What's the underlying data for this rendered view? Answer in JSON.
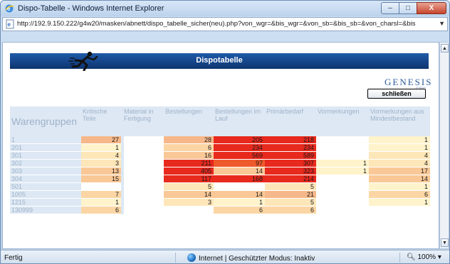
{
  "window": {
    "title": "Dispo-Tabelle - Windows Internet Explorer",
    "url": "http://192.9.150.222/g4w20/masken/abnett/dispo_tabelle_sicher(neu).php?von_wgr=&bis_wgr=&von_sb=&bis_sb=&von_charsl=&bis",
    "controls": {
      "minimize": "–",
      "maximize": "□",
      "close": "X"
    }
  },
  "page": {
    "header_title": "Dispotabelle",
    "logo": {
      "text": "GENESIS",
      "sub": "d Web"
    },
    "close_button": "schließen"
  },
  "table": {
    "columns": [
      "Warengruppen",
      "Kritische Teile",
      "Material in Fertigung",
      "Bestellungen",
      "Bestellungen im Lauf",
      "Primärbedarf",
      "Vormerkungen",
      "Vormerkungen aus Mindestbestand"
    ],
    "rows": [
      {
        "label": "1",
        "cells": [
          "27",
          "",
          "28",
          "205",
          "218",
          "",
          "1"
        ],
        "colors": [
          "#f6b88a",
          "#ffffff",
          "#f6b88a",
          "#e8291d",
          "#e8291d",
          "#ffffff",
          "#fff3cc"
        ]
      },
      {
        "label": "201",
        "cells": [
          "1",
          "",
          "6",
          "234",
          "234",
          "",
          "1"
        ],
        "colors": [
          "#fff3cc",
          "#ffffff",
          "#fbd6a4",
          "#e8291d",
          "#e8291d",
          "#ffffff",
          "#fff3cc"
        ]
      },
      {
        "label": "301",
        "cells": [
          "4",
          "",
          "16",
          "569",
          "589",
          "",
          "4"
        ],
        "colors": [
          "#fde6b8",
          "#ffffff",
          "#f9c896",
          "#e8291d",
          "#e8291d",
          "#ffffff",
          "#fde6b8"
        ]
      },
      {
        "label": "302",
        "cells": [
          "3",
          "",
          "211",
          "97",
          "307",
          "1",
          "4"
        ],
        "colors": [
          "#fde6b8",
          "#ffffff",
          "#e8291d",
          "#ef5a2c",
          "#e8291d",
          "#fff3cc",
          "#fde6b8"
        ]
      },
      {
        "label": "303",
        "cells": [
          "13",
          "",
          "405",
          "14",
          "323",
          "1",
          "17"
        ],
        "colors": [
          "#f9c896",
          "#ffffff",
          "#e8291d",
          "#f9c896",
          "#e8291d",
          "#fff3cc",
          "#f9c896"
        ]
      },
      {
        "label": "304",
        "cells": [
          "15",
          "",
          "117",
          "168",
          "214",
          "",
          "14"
        ],
        "colors": [
          "#f9c896",
          "#ffffff",
          "#e8291d",
          "#e8291d",
          "#e8291d",
          "#ffffff",
          "#f9c896"
        ]
      },
      {
        "label": "501",
        "cells": [
          "",
          "",
          "5",
          "",
          "5",
          "",
          "1"
        ],
        "colors": [
          "#ffffff",
          "#ffffff",
          "#fde6b8",
          "#ffffff",
          "#fde6b8",
          "#ffffff",
          "#fff3cc"
        ]
      },
      {
        "label": "1005",
        "cells": [
          "7",
          "",
          "14",
          "14",
          "21",
          "",
          "6"
        ],
        "colors": [
          "#fbd6a4",
          "#ffffff",
          "#f9c896",
          "#f9c896",
          "#f6b88a",
          "#ffffff",
          "#fbd6a4"
        ]
      },
      {
        "label": "1215",
        "cells": [
          "1",
          "",
          "3",
          "1",
          "5",
          "",
          "1"
        ],
        "colors": [
          "#fff3cc",
          "#ffffff",
          "#fde6b8",
          "#fff3cc",
          "#fde6b8",
          "#ffffff",
          "#fff3cc"
        ]
      },
      {
        "label": "130999",
        "cells": [
          "6",
          "",
          "",
          "6",
          "6",
          "",
          ""
        ],
        "colors": [
          "#fbd6a4",
          "#ffffff",
          "#ffffff",
          "#fbd6a4",
          "#fbd6a4",
          "#ffffff",
          "#ffffff"
        ]
      }
    ]
  },
  "status": {
    "left": "Fertig",
    "zone": "Internet | Geschützter Modus: Inaktiv",
    "zoom": "100%"
  },
  "colors": {
    "header_blue": "#0d3470",
    "table_bg": "#dde8f4",
    "high": "#e8291d",
    "medium": "#f9c896",
    "low": "#fff3cc"
  }
}
